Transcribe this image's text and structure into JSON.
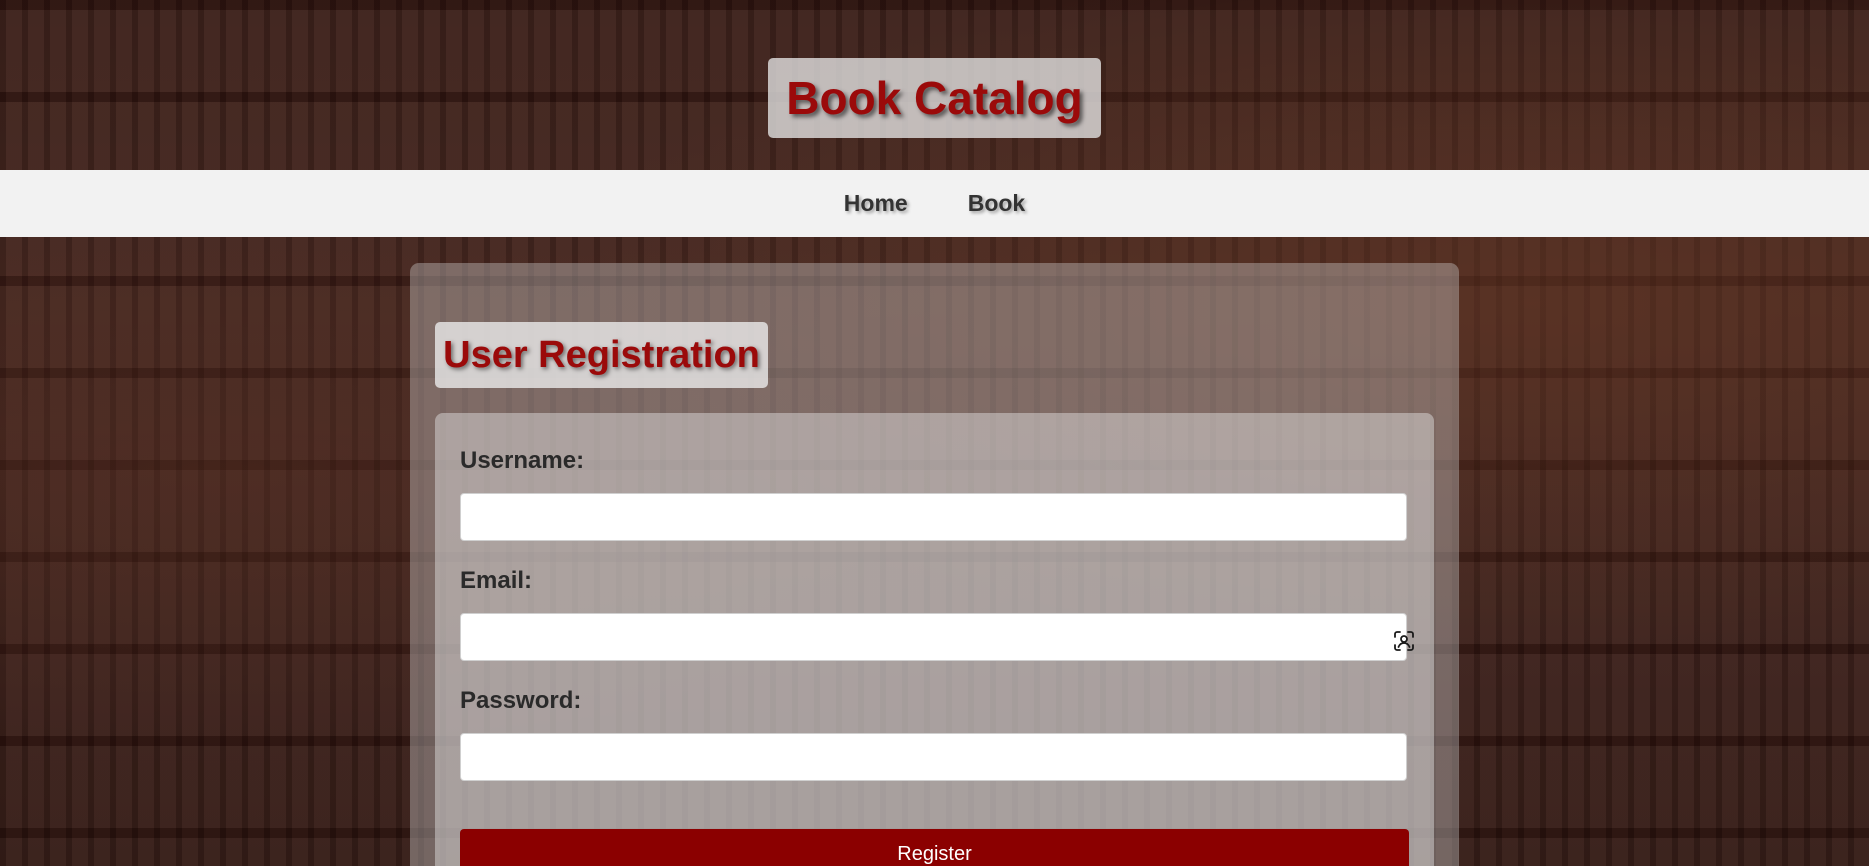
{
  "header": {
    "title": "Book Catalog"
  },
  "nav": {
    "items": [
      {
        "label": "Home"
      },
      {
        "label": "Book"
      }
    ]
  },
  "registration": {
    "title": "User Registration",
    "fields": {
      "username": {
        "label": "Username:",
        "value": "",
        "placeholder": ""
      },
      "email": {
        "label": "Email:",
        "value": "",
        "placeholder": "",
        "icon": "autofill-contact-icon"
      },
      "password": {
        "label": "Password:",
        "value": "",
        "placeholder": ""
      }
    },
    "submit_label": "Register"
  },
  "colors": {
    "accent": "#8b0000",
    "title_text": "#9b0a0a",
    "navbar_bg": "#f2f2f2"
  }
}
